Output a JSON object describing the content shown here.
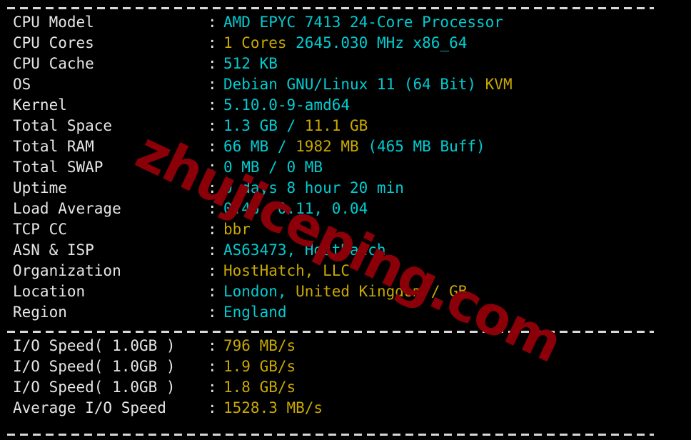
{
  "terminal": {
    "background_color": "#000000",
    "label_color": "#e6e6e6",
    "value_cyan": "#00ccd1",
    "value_yellow": "#c8a800",
    "separator_char": "-",
    "colon": ":"
  },
  "watermark": {
    "text": "zhujiceping.com",
    "color": "#8b0008"
  },
  "system_info": [
    {
      "label": "CPU Model",
      "segments": [
        {
          "text": "AMD EPYC 7413 24-Core Processor",
          "color": "cyan"
        }
      ]
    },
    {
      "label": "CPU Cores",
      "segments": [
        {
          "text": "1 Cores",
          "color": "yellow"
        },
        {
          "text": " 2645.030 MHz x86_64",
          "color": "cyan"
        }
      ]
    },
    {
      "label": "CPU Cache",
      "segments": [
        {
          "text": "512 KB",
          "color": "cyan"
        }
      ]
    },
    {
      "label": "OS",
      "segments": [
        {
          "text": "Debian GNU/Linux 11 (64 Bit) ",
          "color": "cyan"
        },
        {
          "text": "KVM",
          "color": "yellow"
        }
      ]
    },
    {
      "label": "Kernel",
      "segments": [
        {
          "text": "5.10.0-9-amd64",
          "color": "cyan"
        }
      ]
    },
    {
      "label": "Total Space",
      "segments": [
        {
          "text": "1.3 GB / ",
          "color": "cyan"
        },
        {
          "text": "11.1 GB",
          "color": "yellow"
        }
      ]
    },
    {
      "label": "Total RAM",
      "segments": [
        {
          "text": "66 MB / ",
          "color": "cyan"
        },
        {
          "text": "1982 MB",
          "color": "yellow"
        },
        {
          "text": " (465 MB Buff)",
          "color": "cyan"
        }
      ]
    },
    {
      "label": "Total SWAP",
      "segments": [
        {
          "text": "0 MB / 0 MB",
          "color": "cyan"
        }
      ]
    },
    {
      "label": "Uptime",
      "segments": [
        {
          "text": "0 days 8 hour 20 min",
          "color": "cyan"
        }
      ]
    },
    {
      "label": "Load Average",
      "segments": [
        {
          "text": "0.46, 0.11, 0.04",
          "color": "cyan"
        }
      ]
    },
    {
      "label": "TCP CC",
      "segments": [
        {
          "text": "bbr",
          "color": "yellow"
        }
      ]
    },
    {
      "label": "ASN & ISP",
      "segments": [
        {
          "text": "AS63473, HostHatch",
          "color": "cyan"
        }
      ]
    },
    {
      "label": "Organization",
      "segments": [
        {
          "text": "HostHatch, LLC",
          "color": "yellow"
        }
      ]
    },
    {
      "label": "Location",
      "segments": [
        {
          "text": "London, ",
          "color": "cyan"
        },
        {
          "text": "United Kingdom / GB",
          "color": "yellow"
        }
      ]
    },
    {
      "label": "Region",
      "segments": [
        {
          "text": "England",
          "color": "cyan"
        }
      ]
    }
  ],
  "io_info": [
    {
      "label": "I/O Speed( 1.0GB )",
      "segments": [
        {
          "text": "796 MB/s",
          "color": "yellow"
        }
      ]
    },
    {
      "label": "I/O Speed( 1.0GB )",
      "segments": [
        {
          "text": "1.9 GB/s",
          "color": "yellow"
        }
      ]
    },
    {
      "label": "I/O Speed( 1.0GB )",
      "segments": [
        {
          "text": "1.8 GB/s",
          "color": "yellow"
        }
      ]
    },
    {
      "label": "Average I/O Speed",
      "segments": [
        {
          "text": "1528.3 MB/s",
          "color": "yellow"
        }
      ]
    }
  ]
}
